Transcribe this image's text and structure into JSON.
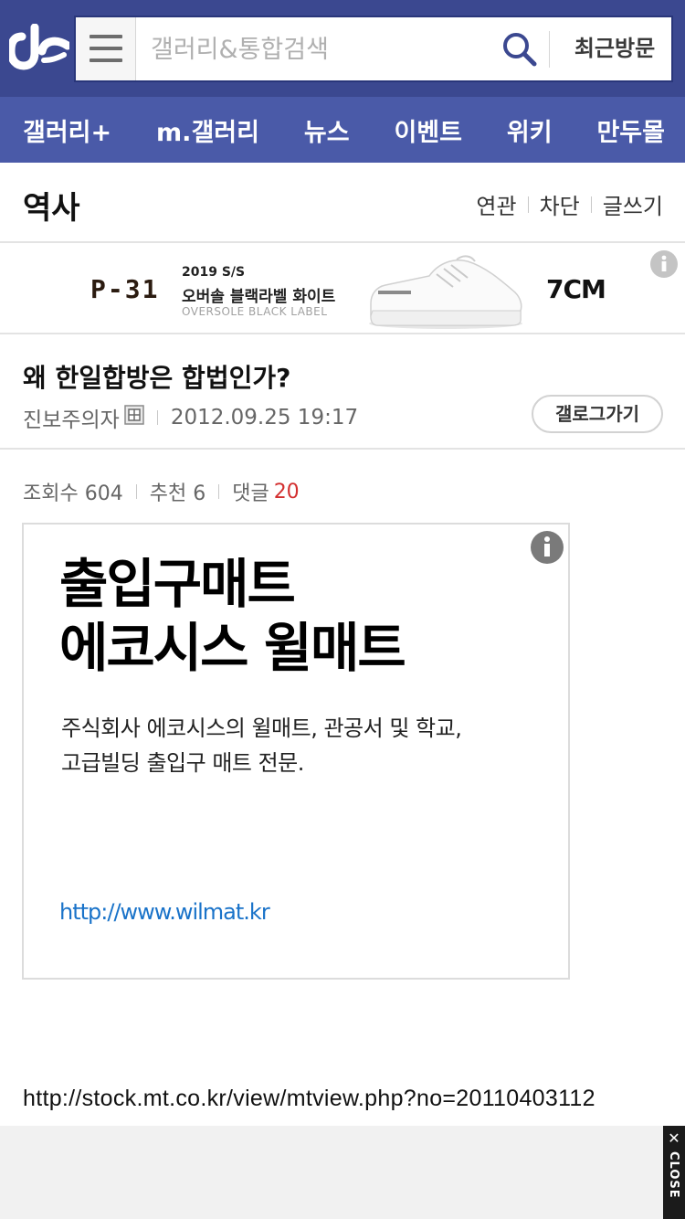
{
  "header": {
    "search_placeholder": "갤러리&통합검색",
    "recent_label": "최근방문",
    "colors": {
      "header_bg": "#3b4890",
      "nav_bg": "#4a5aa8"
    },
    "icons": [
      "dc-logo-icon",
      "hamburger-menu-icon",
      "search-icon"
    ]
  },
  "nav": {
    "items": [
      {
        "label": "갤러리+"
      },
      {
        "label": "m.갤러리"
      },
      {
        "label": "뉴스"
      },
      {
        "label": "이벤트"
      },
      {
        "label": "위키"
      },
      {
        "label": "만두몰"
      }
    ]
  },
  "gallery": {
    "title": "역사",
    "actions": [
      {
        "label": "연관"
      },
      {
        "label": "차단"
      },
      {
        "label": "글쓰기"
      }
    ]
  },
  "banner_ad": {
    "brand": "P-31",
    "season": "2019 S/S",
    "product": "오버솔 블랙라벨 화이트",
    "label_en": "OVERSOLE BLACK LABEL",
    "height": "7CM",
    "icon": "info-icon"
  },
  "post": {
    "title": "왜 한일합방은 합법인가?",
    "author": "진보주의자",
    "datetime": "2012.09.25 19:17",
    "gallog_button": "갤로그가기",
    "stats": {
      "views_label": "조회수 604",
      "recommend_label": "추천 6",
      "comments_label": "댓글",
      "comments_count": "20",
      "comments_color": "#d32f2f"
    }
  },
  "content_ad": {
    "headline_line1": "출입구매트",
    "headline_line2": "에코시스 윌매트",
    "desc_line1": "주식회사 에코시스의 윌매트, 관공서 및 학교,",
    "desc_line2": "고급빌딩 출입구 매트 전문.",
    "url": "http://www.wilmat.kr",
    "url_color": "#1a73c9",
    "icon": "info-icon"
  },
  "body": {
    "link_text": "http://stock.mt.co.kr/view/mtview.php?no=20110403112"
  },
  "bottom_ad": {
    "close_label": "CLOSE",
    "close_symbol": "✕"
  }
}
